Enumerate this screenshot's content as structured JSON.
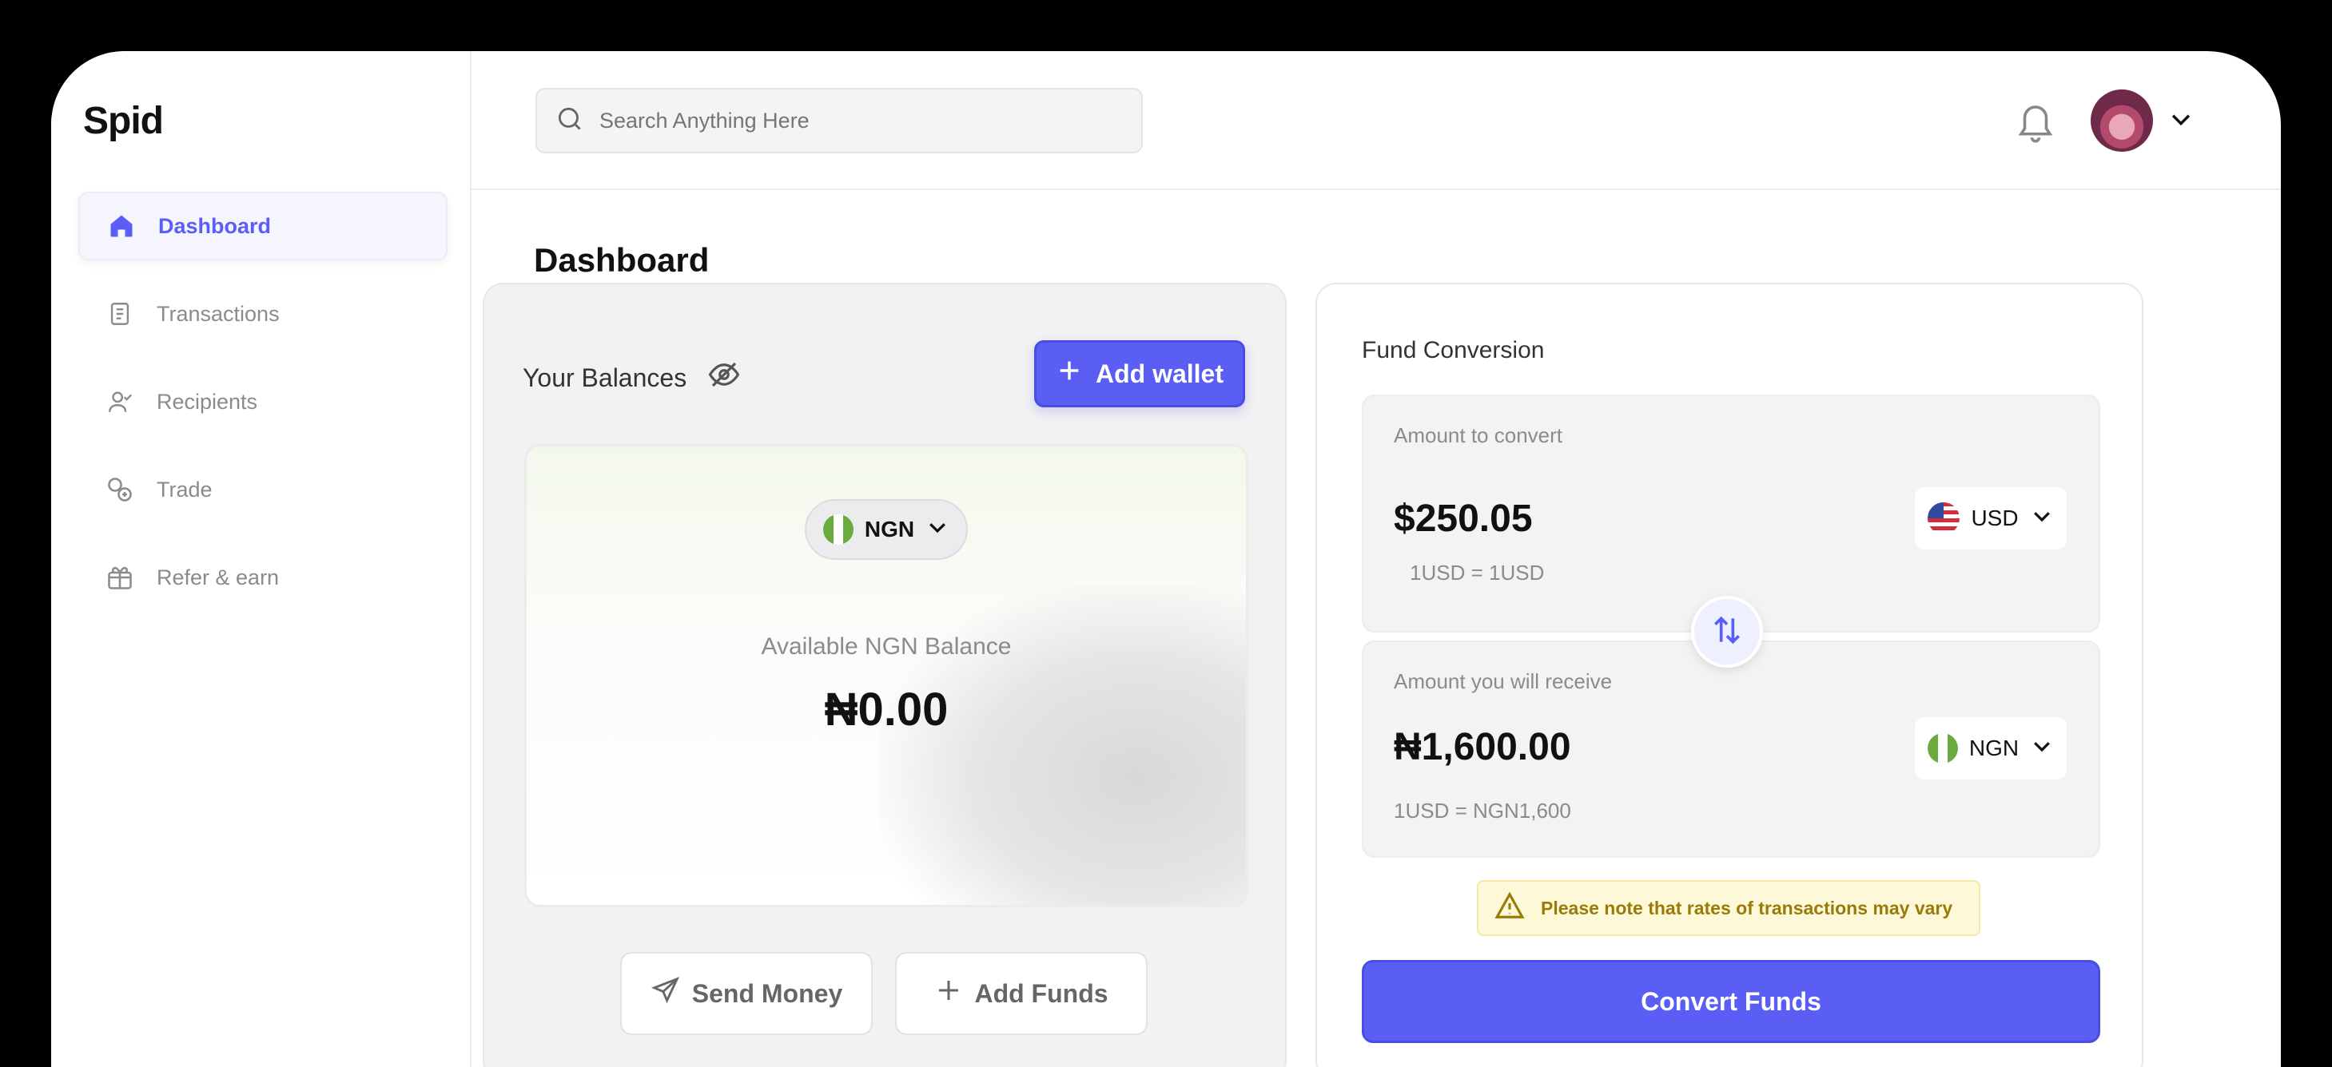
{
  "app": {
    "logo": "Spid"
  },
  "sidebar": {
    "items": [
      {
        "label": "Dashboard",
        "icon": "home-icon",
        "active": true
      },
      {
        "label": "Transactions",
        "icon": "receipt-icon",
        "active": false
      },
      {
        "label": "Recipients",
        "icon": "user-check-icon",
        "active": false
      },
      {
        "label": "Trade",
        "icon": "coins-icon",
        "active": false
      },
      {
        "label": "Refer & earn",
        "icon": "gift-icon",
        "active": false
      }
    ]
  },
  "header": {
    "search_placeholder": "Search Anything Here"
  },
  "main": {
    "title": "Dashboard",
    "balances": {
      "label": "Your Balances",
      "add_wallet_label": "Add wallet",
      "currency": "NGN",
      "available_label": "Available NGN Balance",
      "available_value": "₦0.00",
      "send_money_label": "Send Money",
      "add_funds_label": "Add Funds"
    },
    "conversion": {
      "title": "Fund Conversion",
      "from_label": "Amount to convert",
      "from_amount": "$250.05",
      "from_currency": "USD",
      "from_rate": "1USD = 1USD",
      "to_label": "Amount you will receive",
      "to_amount": "₦1,600.00",
      "to_currency": "NGN",
      "to_rate": "1USD = NGN1,600",
      "notice": "Please note that rates of transactions may vary",
      "convert_label": "Convert Funds"
    }
  },
  "colors": {
    "accent": "#5b5ef4",
    "notice_bg": "#fdf8d8",
    "notice_text": "#9a7b08"
  }
}
